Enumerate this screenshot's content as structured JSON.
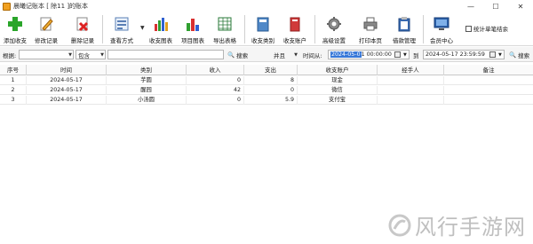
{
  "window": {
    "title": "晨曦记账本    [ 除11 ]的账本",
    "controls": {
      "minimize": "—",
      "maximize": "☐",
      "close": "✕"
    }
  },
  "toolbar": {
    "add": "添加收支",
    "edit": "修改记录",
    "delete": "删除记录",
    "view": "查看方式",
    "income_chart": "收支图表",
    "project_chart": "项目图表",
    "export": "导出表格",
    "category": "收支类别",
    "account": "收支账户",
    "settings": "高级设置",
    "print": "打印本页",
    "backup": "借款管理",
    "member": "会员中心",
    "stat_single": "统计单笔结余"
  },
  "filter": {
    "by_label": "根据:",
    "match_value": "包含",
    "search_label": "搜索",
    "logic_value": "并且",
    "time_from_label": "时间从:",
    "date_from_sel": "2024-05-0",
    "date_from_rest": "1 00:00:00",
    "to_label": "到",
    "date_to": "2024-05-17 23:59:59",
    "search2_label": "搜索"
  },
  "table": {
    "headers": [
      "序号",
      "时间",
      "类别",
      "收入",
      "支出",
      "收支账户",
      "经手人",
      "备注"
    ],
    "rows": [
      {
        "id": "1",
        "date": "2024-05-17",
        "category": "芋圆",
        "income": "0",
        "expense": "8",
        "account": "现金",
        "handler": "",
        "note": ""
      },
      {
        "id": "2",
        "date": "2024-05-17",
        "category": "醒园",
        "income": "42",
        "expense": "0",
        "account": "微信",
        "handler": "",
        "note": ""
      },
      {
        "id": "3",
        "date": "2024-05-17",
        "category": "小汤圆",
        "income": "0",
        "expense": "5.9",
        "account": "支付宝",
        "handler": "",
        "note": ""
      }
    ]
  },
  "watermark": {
    "text": "风行手游网"
  }
}
